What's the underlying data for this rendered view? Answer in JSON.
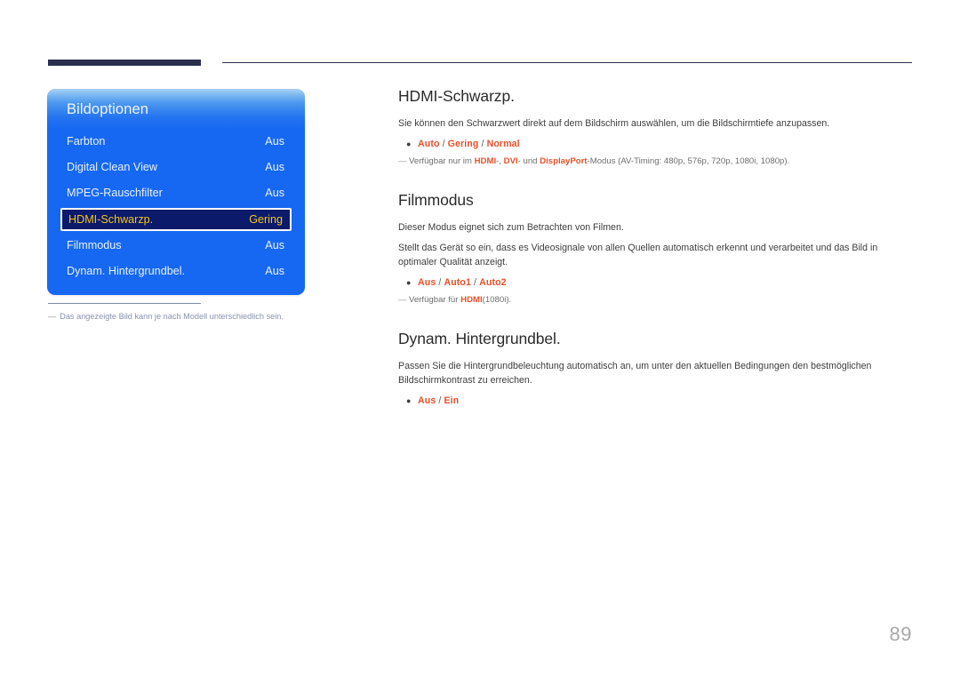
{
  "header": {
    "thick_rule": true,
    "thin_rule": true,
    "accent_color": "#2b2f4e"
  },
  "osd": {
    "title": "Bildoptionen",
    "selected_index": 3,
    "panel_color_top": "#a8d2f5",
    "panel_color_bottom": "#1668f2",
    "selected_bg": "#0b1a6b",
    "selected_text": "#f5c518",
    "rows": [
      {
        "label": "Farbton",
        "value": "Aus"
      },
      {
        "label": "Digital Clean View",
        "value": "Aus"
      },
      {
        "label": "MPEG-Rauschfilter",
        "value": "Aus"
      },
      {
        "label": "HDMI-Schwarzp.",
        "value": "Gering"
      },
      {
        "label": "Filmmodus",
        "value": "Aus"
      },
      {
        "label": "Dynam. Hintergrundbel.",
        "value": "Aus"
      }
    ]
  },
  "panel_note": {
    "dash": "―",
    "text": "Das angezeigte Bild kann je nach Modell unterschiedlich sein."
  },
  "content": {
    "sections": [
      {
        "title": "HDMI-Schwarzp.",
        "paragraphs": [
          "Sie können den Schwarzwert direkt auf dem Bildschirm auswählen, um die Bildschirmtiefe anzupassen."
        ],
        "bullet": {
          "marker": "●",
          "options": [
            "Auto",
            "Gering",
            "Normal"
          ],
          "separator": " / "
        },
        "footnote": {
          "dash": "―",
          "pre": "Verfügbar nur im ",
          "hl1": "HDMI",
          "mid1": "-, ",
          "hl2": "DVI",
          "mid2": "- und ",
          "hl3": "DisplayPort",
          "post": "-Modus (AV-Timing: 480p, 576p, 720p, 1080i, 1080p)."
        }
      },
      {
        "title": "Filmmodus",
        "paragraphs": [
          "Dieser Modus eignet sich zum Betrachten von Filmen.",
          "Stellt das Gerät so ein, dass es Videosignale von allen Quellen automatisch erkennt und verarbeitet und das Bild in optimaler Qualität anzeigt."
        ],
        "bullet": {
          "marker": "●",
          "options": [
            "Aus",
            "Auto1",
            "Auto2"
          ],
          "separator": " / "
        },
        "footnote": {
          "dash": "―",
          "pre": "Verfügbar für ",
          "hl1": "HDMI",
          "mid1": "",
          "hl2": "",
          "mid2": "",
          "hl3": "",
          "post": "(1080i)."
        }
      },
      {
        "title": "Dynam. Hintergrundbel.",
        "paragraphs": [
          "Passen Sie die Hintergrundbeleuchtung automatisch an, um unter den aktuellen Bedingungen den bestmöglichen Bildschirmkontrast zu erreichen."
        ],
        "bullet": {
          "marker": "●",
          "options": [
            "Aus",
            "Ein"
          ],
          "separator": " / "
        },
        "footnote": null
      }
    ],
    "option_color": "#e8502a"
  },
  "page_number": "89"
}
